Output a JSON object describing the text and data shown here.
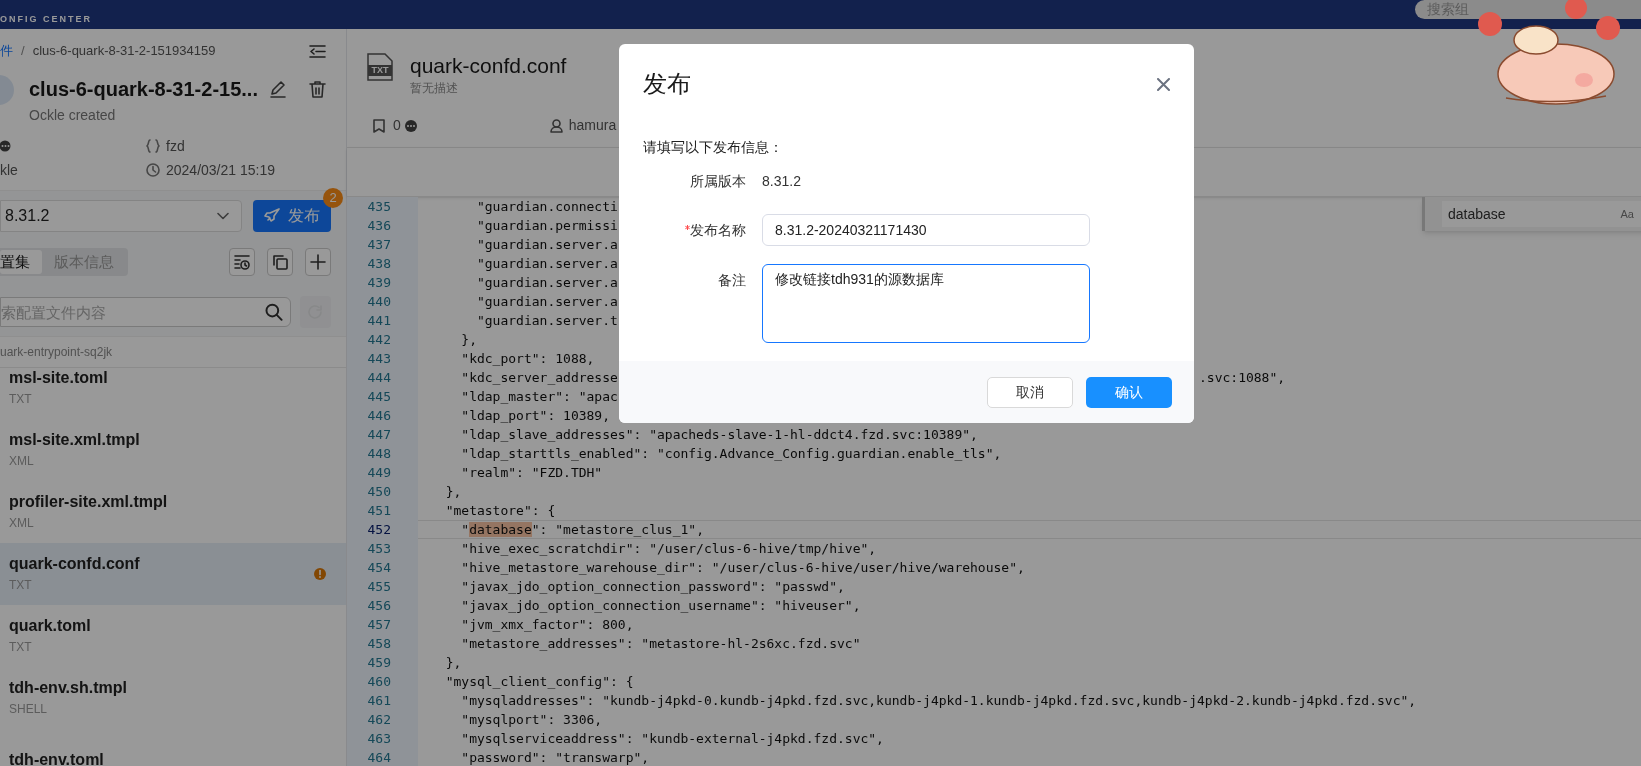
{
  "header": {
    "logo_subtitle": "ONFIG CENTER",
    "search": {
      "placeholder": "搜索组"
    }
  },
  "sidebar": {
    "breadcrumb": {
      "separator": "/",
      "items": [
        {
          "text": "件",
          "link": true
        },
        {
          "text": "clus-6-quark-8-31-2-151934159",
          "link": false
        }
      ]
    },
    "title": "clus-6-quark-8-31-2-15...",
    "subtitle": "Ockle created",
    "namespace": "fzd",
    "creator": "kle",
    "created_at": "2024/03/21 15:19",
    "version_select": {
      "value": "8.31.2"
    },
    "publish_button": {
      "label": "发布",
      "badge": "2"
    },
    "tabs": [
      {
        "label": "置集",
        "selected": true
      },
      {
        "label": "版本信息",
        "selected": false
      }
    ],
    "search": {
      "placeholder": "索配置文件内容"
    },
    "group": "uark-entrypoint-sq2jk",
    "files": [
      {
        "name": "msl-site.toml",
        "type": "TXT",
        "selected": false,
        "warning": false
      },
      {
        "name": "msl-site.xml.tmpl",
        "type": "XML",
        "selected": false,
        "warning": false
      },
      {
        "name": "profiler-site.xml.tmpl",
        "type": "XML",
        "selected": false,
        "warning": false
      },
      {
        "name": "quark-confd.conf",
        "type": "TXT",
        "selected": true,
        "warning": true
      },
      {
        "name": "quark.toml",
        "type": "TXT",
        "selected": false,
        "warning": false
      },
      {
        "name": "tdh-env.sh.tmpl",
        "type": "SHELL",
        "selected": false,
        "warning": false
      },
      {
        "name": "tdh-env.toml",
        "selected": false,
        "warning": false
      }
    ]
  },
  "file": {
    "icon_label": "TXT",
    "name": "quark-confd.conf",
    "description": "暂无描述",
    "bookmarks": "0",
    "owner": "hamura"
  },
  "editor": {
    "find": {
      "value": "database",
      "case_label": "Aa"
    },
    "lines": [
      {
        "number": "435",
        "text": "      \"guardian.connecti",
        "active": false
      },
      {
        "number": "436",
        "text": "      \"guardian.permissi",
        "active": false
      },
      {
        "number": "437",
        "text": "      \"guardian.server.a",
        "active": false
      },
      {
        "number": "438",
        "text": "      \"guardian.server.a",
        "active": false
      },
      {
        "number": "439",
        "text": "      \"guardian.server.a",
        "active": false
      },
      {
        "number": "440",
        "text": "      \"guardian.server.a",
        "active": false
      },
      {
        "number": "441",
        "text": "      \"guardian.server.t",
        "active": false
      },
      {
        "number": "442",
        "text": "    },",
        "active": false
      },
      {
        "number": "443",
        "text": "    \"kdc_port\": 1088,",
        "active": false
      },
      {
        "number": "444",
        "text": "    \"kdc_server_addresse",
        "tail": ".svc:1088\",",
        "active": false
      },
      {
        "number": "445",
        "text": "    \"ldap_master\": \"apac",
        "active": false
      },
      {
        "number": "446",
        "text": "    \"ldap_port\": 10389,",
        "active": false
      },
      {
        "number": "447",
        "text": "    \"ldap_slave_addresses\": \"apacheds-slave-1-hl-ddct4.fzd.svc:10389\",",
        "active": false
      },
      {
        "number": "448",
        "text": "    \"ldap_starttls_enabled\": \"config.Advance_Config.guardian.enable_tls\",",
        "active": false
      },
      {
        "number": "449",
        "text": "    \"realm\": \"FZD.TDH\"",
        "active": false
      },
      {
        "number": "450",
        "text": "  },",
        "active": false
      },
      {
        "number": "451",
        "text": "  \"metastore\": {",
        "active": false
      },
      {
        "number": "452",
        "segments": [
          {
            "text": "    \"",
            "match": false
          },
          {
            "text": "database",
            "match": true
          },
          {
            "text": "\": \"metastore_clus_1\",",
            "match": false
          }
        ],
        "active": true
      },
      {
        "number": "453",
        "text": "    \"hive_exec_scratchdir\": \"/user/clus-6-hive/tmp/hive\",",
        "active": false
      },
      {
        "number": "454",
        "text": "    \"hive_metastore_warehouse_dir\": \"/user/clus-6-hive/user/hive/warehouse\",",
        "active": false
      },
      {
        "number": "455",
        "text": "    \"javax_jdo_option_connection_password\": \"passwd\",",
        "active": false
      },
      {
        "number": "456",
        "text": "    \"javax_jdo_option_connection_username\": \"hiveuser\",",
        "active": false
      },
      {
        "number": "457",
        "text": "    \"jvm_xmx_factor\": 800,",
        "active": false
      },
      {
        "number": "458",
        "text": "    \"metastore_addresses\": \"metastore-hl-2s6xc.fzd.svc\"",
        "active": false
      },
      {
        "number": "459",
        "text": "  },",
        "active": false
      },
      {
        "number": "460",
        "text": "  \"mysql_client_config\": {",
        "active": false
      },
      {
        "number": "461",
        "text": "    \"mysqladdresses\": \"kundb-j4pkd-0.kundb-j4pkd.fzd.svc,kundb-j4pkd-1.kundb-j4pkd.fzd.svc,kundb-j4pkd-2.kundb-j4pkd.fzd.svc\",",
        "active": false
      },
      {
        "number": "462",
        "text": "    \"mysqlport\": 3306,",
        "active": false
      },
      {
        "number": "463",
        "text": "    \"mysqlserviceaddress\": \"kundb-external-j4pkd.fzd.svc\",",
        "active": false
      },
      {
        "number": "464",
        "text": "    \"password\": \"transwarp\",",
        "active": false
      }
    ]
  },
  "dialog": {
    "title": "发布",
    "intro": "请填写以下发布信息：",
    "fields": [
      {
        "kind": "static",
        "label": "所属版本",
        "value": "8.31.2",
        "required": false
      },
      {
        "kind": "input",
        "label": "发布名称",
        "value": "8.31.2-20240321171430",
        "required": true,
        "focused": false
      },
      {
        "kind": "textarea",
        "label": "备注",
        "value": "修改链接tdh931的源数据库",
        "required": false,
        "focused": true
      }
    ],
    "buttons": [
      {
        "label": "取消",
        "primary": false
      },
      {
        "label": "确认",
        "primary": true
      }
    ]
  }
}
